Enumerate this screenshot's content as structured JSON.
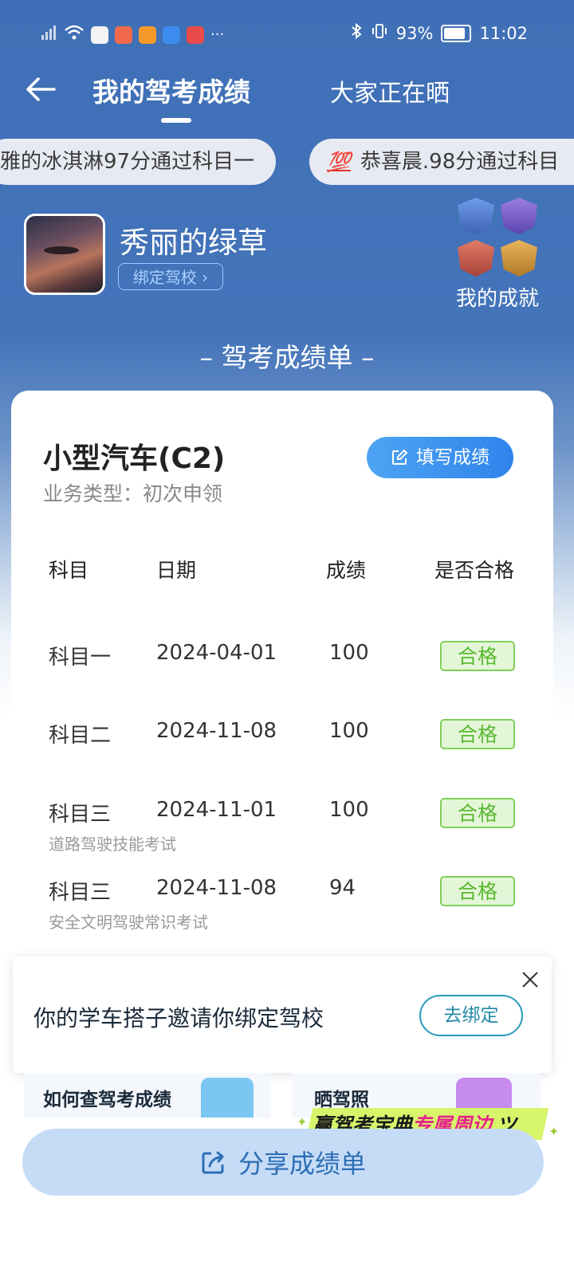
{
  "status_bar": {
    "battery": "93%",
    "time": "11:02",
    "more": "···"
  },
  "header": {
    "tab_active": "我的驾考成绩",
    "tab_other": "大家正在晒"
  },
  "ticker": {
    "item1": "雅的冰淇淋97分通过科目一",
    "item2_icon": "💯",
    "item2": "恭喜晨.98分通过科目"
  },
  "profile": {
    "username": "秀丽的绿草",
    "bind_school": "绑定驾校",
    "achievements_label": "我的成就"
  },
  "section_title": "– 驾考成绩单 –",
  "card": {
    "vehicle_type": "小型汽车(C2)",
    "business_type": "业务类型：初次申领",
    "fill_score_button": "填写成绩",
    "columns": [
      "科目",
      "日期",
      "成绩",
      "是否合格"
    ],
    "rows": [
      {
        "subject": "科目一",
        "date": "2024-04-01",
        "score": "100",
        "result": "合格",
        "note": ""
      },
      {
        "subject": "科目二",
        "date": "2024-11-08",
        "score": "100",
        "result": "合格",
        "note": ""
      },
      {
        "subject": "科目三",
        "date": "2024-11-01",
        "score": "100",
        "result": "合格",
        "note": "道路驾驶技能考试"
      },
      {
        "subject": "科目三",
        "date": "2024-11-08",
        "score": "94",
        "result": "合格",
        "note": "安全文明驾驶常识考试"
      }
    ]
  },
  "invite": {
    "text": "你的学车搭子邀请你绑定驾校",
    "button": "去绑定"
  },
  "bottom_cards": {
    "card1": "如何查驾考成绩",
    "card2": "晒驾照"
  },
  "promo": {
    "part1": "赢驾考宝典",
    "part2": "专属周边"
  },
  "share_button": "分享成绩单",
  "colors": {
    "header_blue": "#3f6fb6",
    "pass_green": "#5ab831",
    "button_blue": "#2f84ec"
  }
}
